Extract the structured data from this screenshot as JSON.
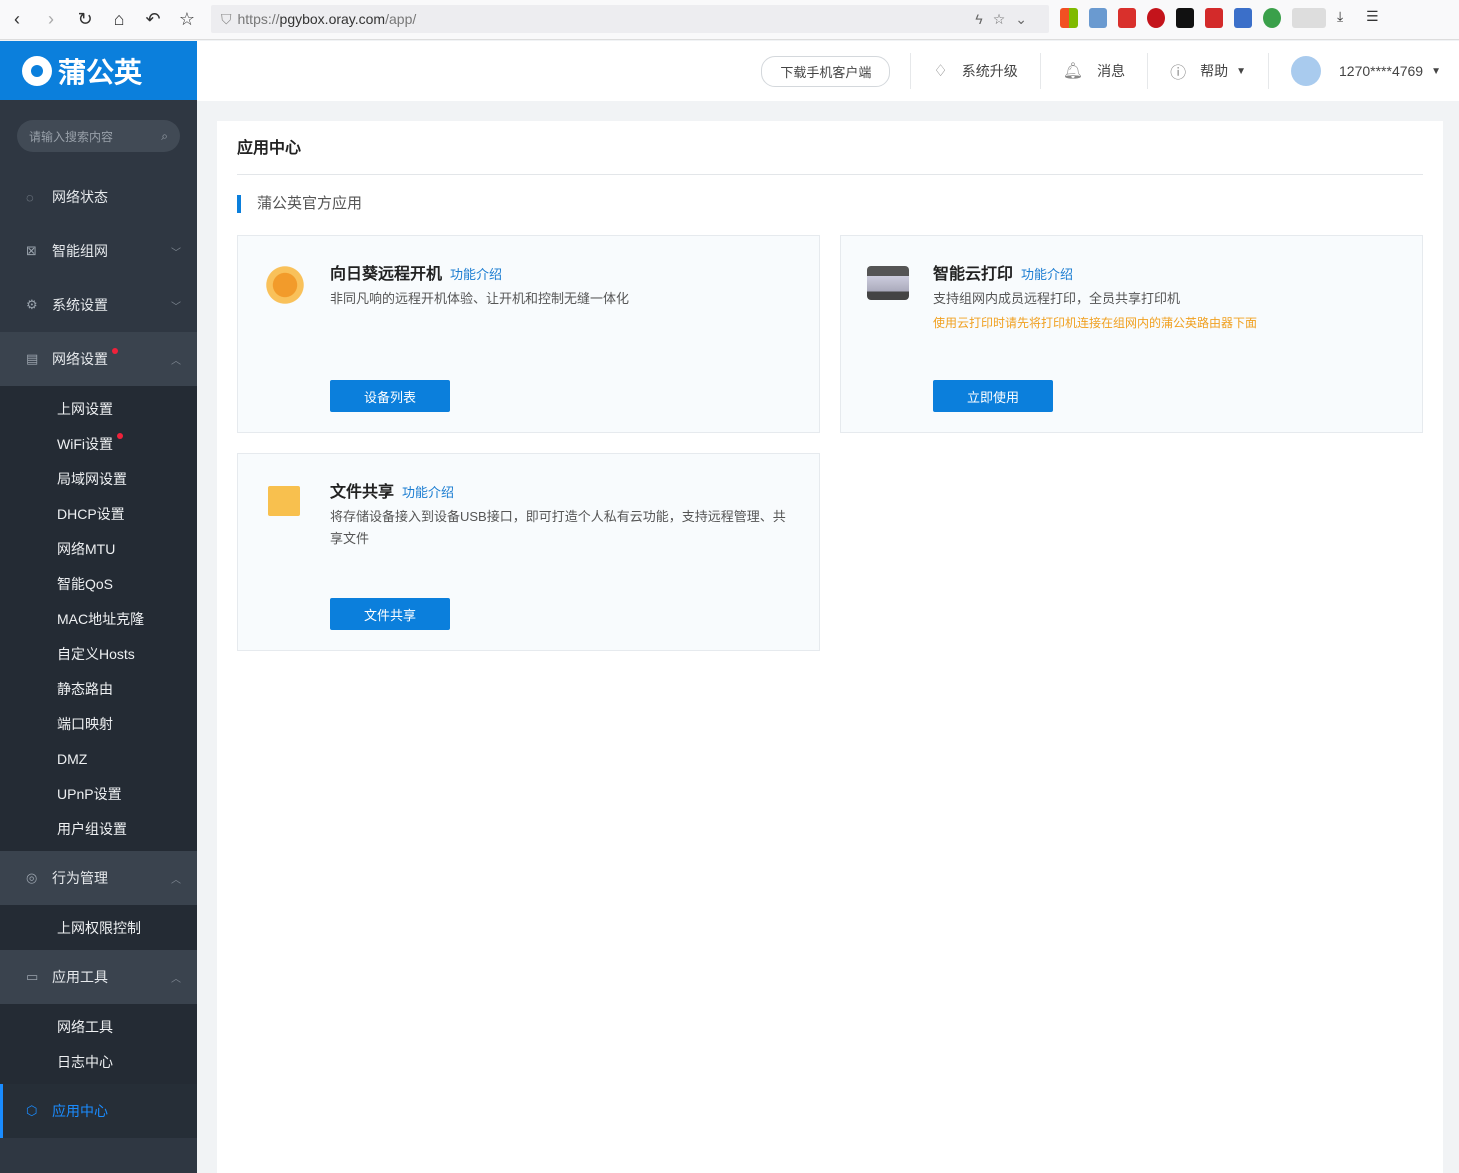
{
  "browser": {
    "url_prefix": "https://",
    "url_host": "pgybox.oray.com",
    "url_path": "/app/"
  },
  "brand": {
    "name": "蒲公英",
    "color": "#0b7fdc"
  },
  "search": {
    "placeholder": "请输入搜索内容"
  },
  "sidebar": {
    "items": [
      {
        "label": "网络状态"
      },
      {
        "label": "智能组网"
      },
      {
        "label": "系统设置"
      },
      {
        "label": "网络设置"
      }
    ],
    "network_settings": [
      "上网设置",
      "WiFi设置",
      "局域网设置",
      "DHCP设置",
      "网络MTU",
      "智能QoS",
      "MAC地址克隆",
      "自定义Hosts",
      "静态路由",
      "端口映射",
      "DMZ",
      "UPnP设置",
      "用户组设置"
    ],
    "behavior": {
      "label": "行为管理",
      "sub": [
        "上网权限控制"
      ]
    },
    "tools": {
      "label": "应用工具",
      "sub": [
        "网络工具",
        "日志中心"
      ]
    },
    "app_center": "应用中心"
  },
  "topbar": {
    "download": "下载手机客户端",
    "upgrade": "系统升级",
    "messages": "消息",
    "help": "帮助",
    "user": "1270****4769"
  },
  "page": {
    "title": "应用中心",
    "section": "蒲公英官方应用"
  },
  "cards": [
    {
      "title": "向日葵远程开机",
      "intro": "功能介绍",
      "desc": "非同凡响的远程开机体验、让开机和控制无缝一体化",
      "button": "设备列表"
    },
    {
      "title": "智能云打印",
      "intro": "功能介绍",
      "desc": "支持组网内成员远程打印，全员共享打印机",
      "warning": "使用云打印时请先将打印机连接在组网内的蒲公英路由器下面",
      "button": "立即使用"
    },
    {
      "title": "文件共享",
      "intro": "功能介绍",
      "desc": "将存储设备接入到设备USB接口，即可打造个人私有云功能，支持远程管理、共享文件",
      "button": "文件共享"
    }
  ]
}
